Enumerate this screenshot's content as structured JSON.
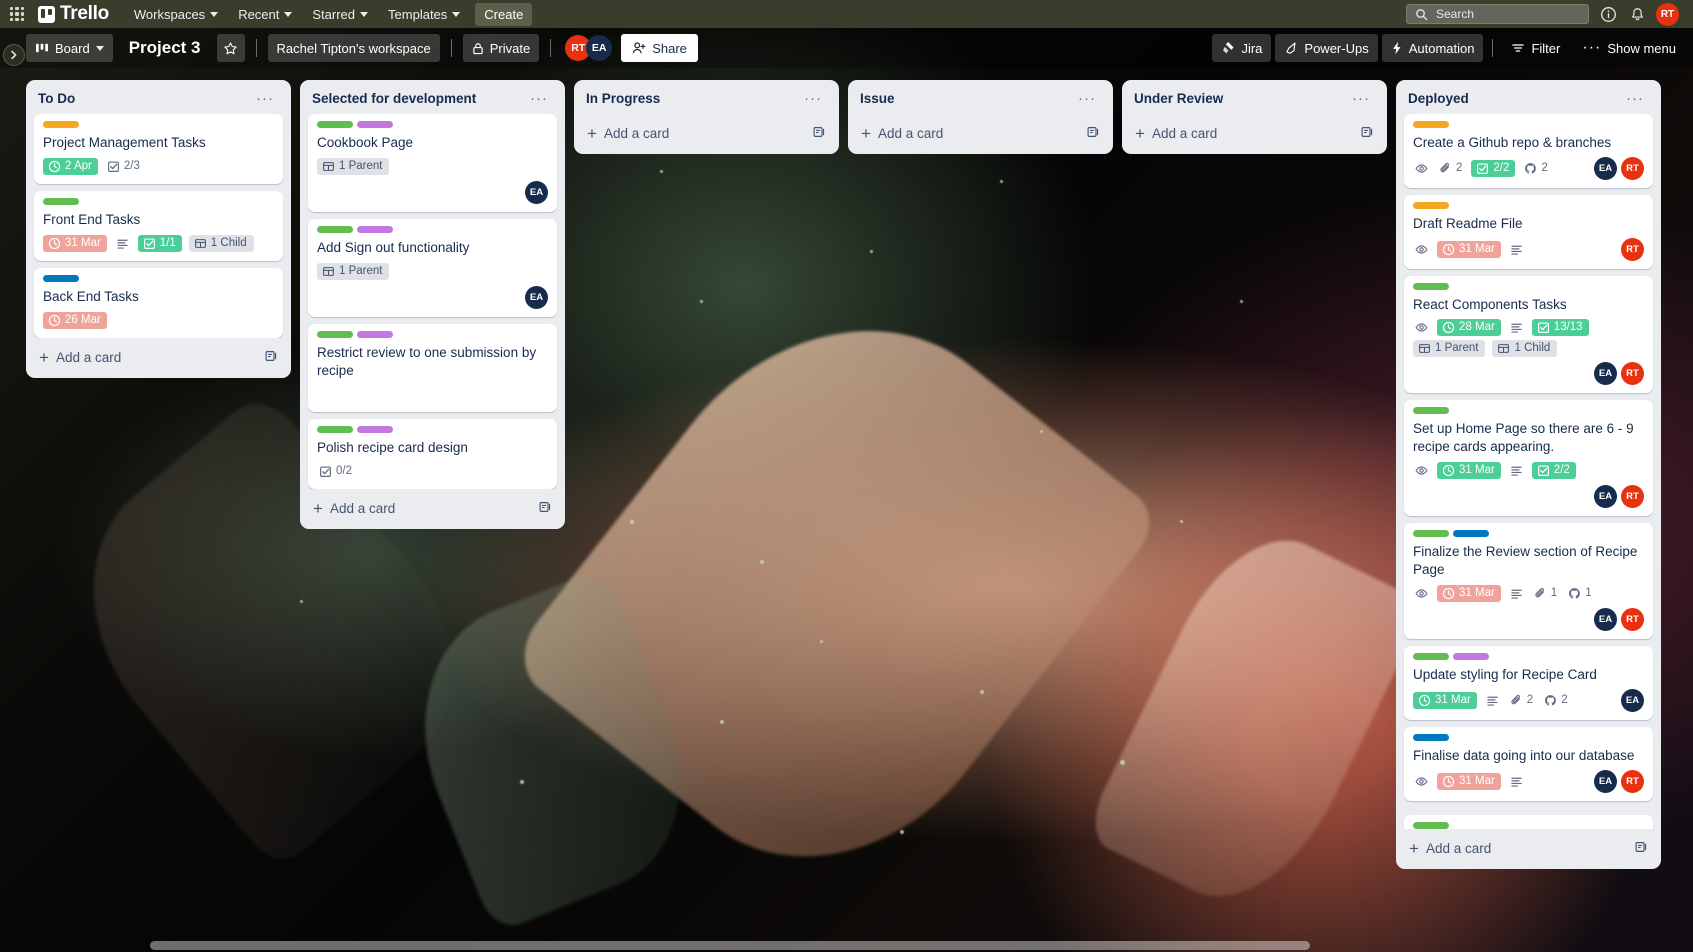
{
  "topnav": {
    "apps_icon": "apps-grid-icon",
    "brand": "Trello",
    "items": [
      {
        "label": "Workspaces",
        "has_caret": true
      },
      {
        "label": "Recent",
        "has_caret": true
      },
      {
        "label": "Starred",
        "has_caret": true
      },
      {
        "label": "Templates",
        "has_caret": true
      }
    ],
    "create_label": "Create",
    "search_placeholder": "Search",
    "info_icon": "info-icon",
    "notifications_icon": "bell-icon",
    "account_initials": "RT"
  },
  "boardbar": {
    "view_label": "Board",
    "title": "Project 3",
    "star_icon": "star-icon",
    "workspace": "Rachel Tipton's workspace",
    "visibility": "Private",
    "members": [
      {
        "initials": "RT",
        "color": "#e8310e"
      },
      {
        "initials": "EA",
        "color": "#172b4d"
      }
    ],
    "share_label": "Share",
    "right_buttons": [
      {
        "label": "Jira",
        "icon": "jira-icon"
      },
      {
        "label": "Power-Ups",
        "icon": "rocket-icon"
      },
      {
        "label": "Automation",
        "icon": "bolt-icon"
      },
      {
        "label": "Filter",
        "icon": "filter-icon"
      },
      {
        "label": "Show menu",
        "icon": "ellipsis-icon"
      }
    ]
  },
  "colors": {
    "label_orange": "#f5a623",
    "label_green": "#61bd4f",
    "label_blue": "#0079bf",
    "label_purple": "#c377e0",
    "due_green": "#4bce97",
    "due_red": "#f0a39a",
    "avatar_red": "#e8310e",
    "avatar_navy": "#172b4d",
    "list_bg": "#ebecf0",
    "topnav_bg": "#3a3d2b"
  },
  "add_card_label": "Add a card",
  "lists": [
    {
      "title": "To Do",
      "cards": [
        {
          "title": "Project Management Tasks",
          "labels": [
            "#f5a623"
          ],
          "badges": [
            {
              "type": "due",
              "state": "green",
              "text": "2 Apr"
            },
            {
              "type": "checklist",
              "state": "plain",
              "text": "2/3"
            }
          ],
          "members": []
        },
        {
          "title": "Front End Tasks",
          "labels": [
            "#61bd4f"
          ],
          "badges": [
            {
              "type": "due",
              "state": "red",
              "text": "31 Mar"
            },
            {
              "type": "description",
              "state": "plain",
              "text": ""
            },
            {
              "type": "checklist",
              "state": "green",
              "text": "1/1"
            },
            {
              "type": "relation",
              "state": "rel",
              "text": "1 Child"
            }
          ],
          "members": []
        },
        {
          "title": "Back End Tasks",
          "labels": [
            "#0079bf"
          ],
          "badges": [
            {
              "type": "due",
              "state": "red",
              "text": "26 Mar"
            }
          ],
          "members": []
        }
      ]
    },
    {
      "title": "Selected for development",
      "cards": [
        {
          "title": "Cookbook Page",
          "labels": [
            "#61bd4f",
            "#c377e0"
          ],
          "badges": [
            {
              "type": "relation",
              "state": "rel",
              "text": "1 Parent"
            }
          ],
          "members": [
            {
              "initials": "EA",
              "color": "#172b4d"
            }
          ]
        },
        {
          "title": "Add Sign out functionality",
          "labels": [
            "#61bd4f",
            "#c377e0"
          ],
          "badges": [
            {
              "type": "relation",
              "state": "rel",
              "text": "1 Parent"
            }
          ],
          "members": [
            {
              "initials": "EA",
              "color": "#172b4d"
            }
          ]
        },
        {
          "title": "Restrict review to one submission by recipe",
          "labels": [
            "#61bd4f",
            "#c377e0"
          ],
          "badges": [],
          "members": []
        },
        {
          "title": "Polish recipe card design",
          "labels": [
            "#61bd4f",
            "#c377e0"
          ],
          "badges": [
            {
              "type": "checklist",
              "state": "plain",
              "text": "0/2"
            }
          ],
          "members": []
        }
      ]
    },
    {
      "title": "In Progress",
      "cards": []
    },
    {
      "title": "Issue",
      "cards": []
    },
    {
      "title": "Under Review",
      "cards": []
    },
    {
      "title": "Deployed",
      "cards": [
        {
          "title": "Create a Github repo & branches",
          "labels": [
            "#f5a623"
          ],
          "badges": [
            {
              "type": "watch",
              "state": "plain",
              "text": ""
            },
            {
              "type": "attachment",
              "state": "plain",
              "text": "2"
            },
            {
              "type": "checklist",
              "state": "green",
              "text": "2/2"
            },
            {
              "type": "github",
              "state": "plain",
              "text": "2"
            }
          ],
          "members": [
            {
              "initials": "EA",
              "color": "#172b4d"
            },
            {
              "initials": "RT",
              "color": "#e8310e"
            }
          ],
          "members_inline": true
        },
        {
          "title": "Draft Readme File",
          "labels": [
            "#f5a623"
          ],
          "badges": [
            {
              "type": "watch",
              "state": "plain",
              "text": ""
            },
            {
              "type": "due",
              "state": "red",
              "text": "31 Mar"
            },
            {
              "type": "description",
              "state": "plain",
              "text": ""
            }
          ],
          "members": [
            {
              "initials": "RT",
              "color": "#e8310e"
            }
          ],
          "members_inline": true
        },
        {
          "title": "React Components Tasks",
          "labels": [
            "#61bd4f"
          ],
          "badges": [
            {
              "type": "watch",
              "state": "plain",
              "text": ""
            },
            {
              "type": "due",
              "state": "green",
              "text": "28 Mar"
            },
            {
              "type": "description",
              "state": "plain",
              "text": ""
            },
            {
              "type": "checklist",
              "state": "green",
              "text": "13/13"
            },
            {
              "type": "relation",
              "state": "rel",
              "text": "1 Parent"
            },
            {
              "type": "relation",
              "state": "rel",
              "text": "1 Child"
            }
          ],
          "members": [
            {
              "initials": "EA",
              "color": "#172b4d"
            },
            {
              "initials": "RT",
              "color": "#e8310e"
            }
          ]
        },
        {
          "title": "Set up Home Page so there are 6 - 9 recipe cards appearing.",
          "labels": [
            "#61bd4f"
          ],
          "badges": [
            {
              "type": "watch",
              "state": "plain",
              "text": ""
            },
            {
              "type": "due",
              "state": "green",
              "text": "31 Mar"
            },
            {
              "type": "description",
              "state": "plain",
              "text": ""
            },
            {
              "type": "checklist",
              "state": "green",
              "text": "2/2"
            }
          ],
          "members": [
            {
              "initials": "EA",
              "color": "#172b4d"
            },
            {
              "initials": "RT",
              "color": "#e8310e"
            }
          ]
        },
        {
          "title": "Finalize the Review section of Recipe Page",
          "labels": [
            "#61bd4f",
            "#0079bf"
          ],
          "badges": [
            {
              "type": "watch",
              "state": "plain",
              "text": ""
            },
            {
              "type": "due",
              "state": "red",
              "text": "31 Mar"
            },
            {
              "type": "description",
              "state": "plain",
              "text": ""
            },
            {
              "type": "attachment",
              "state": "plain",
              "text": "1"
            },
            {
              "type": "github",
              "state": "plain",
              "text": "1"
            }
          ],
          "members": [
            {
              "initials": "EA",
              "color": "#172b4d"
            },
            {
              "initials": "RT",
              "color": "#e8310e"
            }
          ]
        },
        {
          "title": "Update styling for Recipe Card",
          "labels": [
            "#61bd4f",
            "#c377e0"
          ],
          "badges": [
            {
              "type": "due",
              "state": "green",
              "text": "31 Mar"
            },
            {
              "type": "description",
              "state": "plain",
              "text": ""
            },
            {
              "type": "attachment",
              "state": "plain",
              "text": "2"
            },
            {
              "type": "github",
              "state": "plain",
              "text": "2"
            }
          ],
          "members": [
            {
              "initials": "EA",
              "color": "#172b4d"
            }
          ],
          "members_inline": true
        },
        {
          "title": "Finalise data going into our database",
          "labels": [
            "#0079bf"
          ],
          "badges": [
            {
              "type": "watch",
              "state": "plain",
              "text": ""
            },
            {
              "type": "due",
              "state": "red",
              "text": "31 Mar"
            },
            {
              "type": "description",
              "state": "plain",
              "text": ""
            }
          ],
          "members": [
            {
              "initials": "EA",
              "color": "#172b4d"
            },
            {
              "initials": "RT",
              "color": "#e8310e"
            }
          ],
          "members_inline": true
        },
        {
          "title": "",
          "labels": [
            "#61bd4f"
          ],
          "badges": [],
          "members": [],
          "partial": true
        }
      ]
    }
  ]
}
